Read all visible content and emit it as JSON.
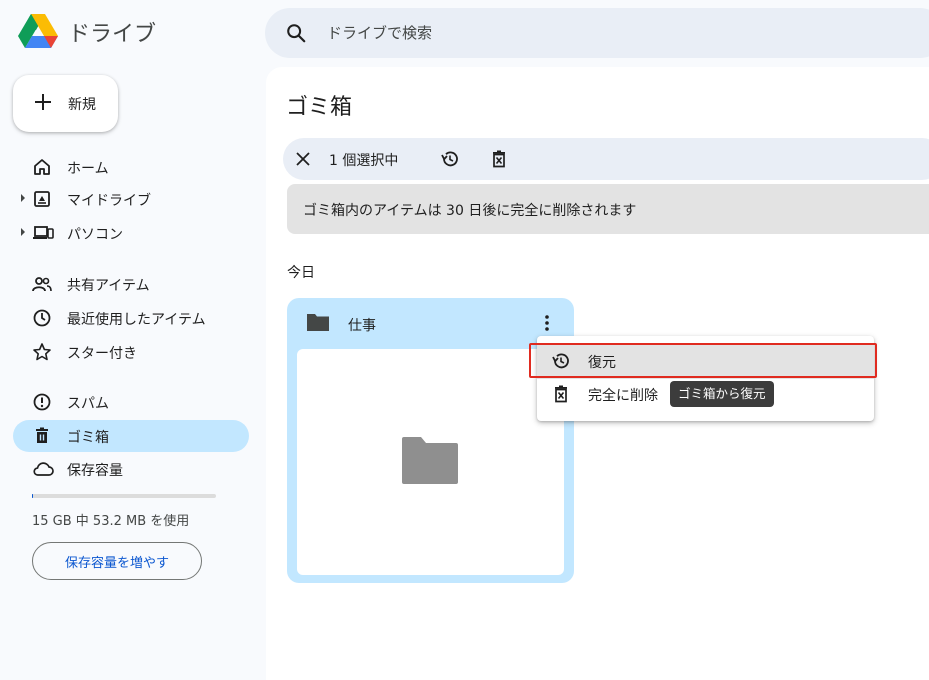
{
  "app": {
    "name": "ドライブ"
  },
  "search": {
    "placeholder": "ドライブで検索"
  },
  "sidebar": {
    "new_label": "新規",
    "items": [
      {
        "label": "ホーム",
        "icon": "home-icon"
      },
      {
        "label": "マイドライブ",
        "icon": "my-drive-icon"
      },
      {
        "label": "パソコン",
        "icon": "computers-icon"
      },
      {
        "label": "共有アイテム",
        "icon": "shared-icon"
      },
      {
        "label": "最近使用したアイテム",
        "icon": "recent-icon"
      },
      {
        "label": "スター付き",
        "icon": "star-icon"
      },
      {
        "label": "スパム",
        "icon": "spam-icon"
      },
      {
        "label": "ゴミ箱",
        "icon": "trash-icon",
        "active": true
      },
      {
        "label": "保存容量",
        "icon": "cloud-icon"
      }
    ],
    "storage_used_fraction": 0.0035,
    "storage_text": "15 GB 中 53.2 MB を使用",
    "storage_button": "保存容量を増やす"
  },
  "main": {
    "title": "ゴミ箱",
    "selection": {
      "count_text": "1 個選択中"
    },
    "notice": "ゴミ箱内のアイテムは 30 日後に完全に削除されます",
    "section": "今日",
    "card": {
      "name": "仕事"
    }
  },
  "context_menu": {
    "items": [
      {
        "label": "復元",
        "icon": "restore-icon"
      },
      {
        "label": "完全に削除",
        "icon": "delete-forever-icon"
      }
    ],
    "tooltip": "ゴミ箱から復元"
  },
  "colors": {
    "accent": "#0b57d0",
    "active_nav": "#c2e7ff",
    "highlight_box": "#e02b20"
  }
}
